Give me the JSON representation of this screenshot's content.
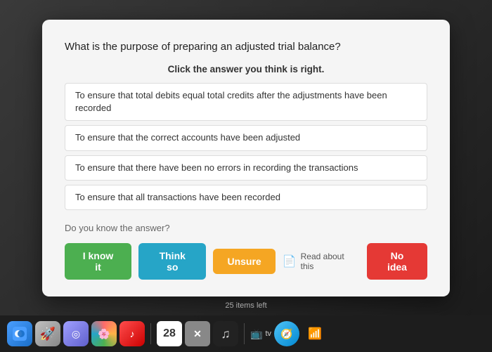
{
  "card": {
    "question": "What is the purpose of preparing an adjusted trial balance?",
    "instruction": "Click the answer you think is right.",
    "answers": [
      {
        "id": "a1",
        "text": "To ensure that total debits equal total credits after the adjustments have been recorded"
      },
      {
        "id": "a2",
        "text": "To ensure that the correct accounts have been adjusted"
      },
      {
        "id": "a3",
        "text": "To ensure that there have been no errors in recording the transactions"
      },
      {
        "id": "a4",
        "text": "To ensure that all transactions have been recorded"
      }
    ],
    "do_you_know_label": "Do you know the answer?",
    "buttons": {
      "iknow": "I know it",
      "thinkso": "Think so",
      "unsure": "Unsure",
      "noidea": "No idea"
    },
    "read_about": "Read about this"
  },
  "taskbar": {
    "items_left": "25 items left",
    "date": "28",
    "tv_label": "tv"
  }
}
